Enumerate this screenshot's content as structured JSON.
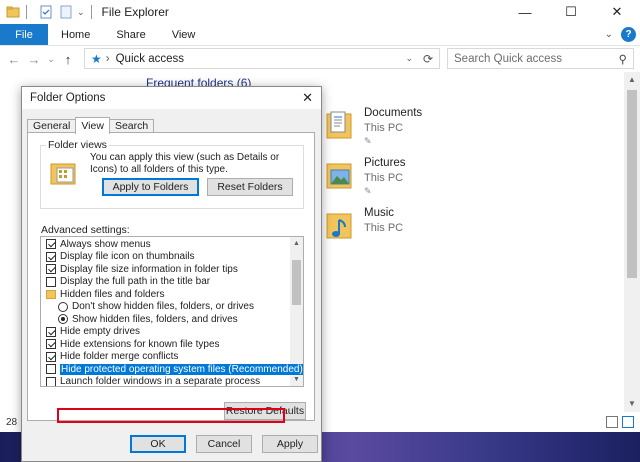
{
  "window": {
    "title": "File Explorer",
    "controls": [
      "—",
      "☐",
      "✕"
    ]
  },
  "ribbon": {
    "file_tab": "File",
    "tabs": [
      "Home",
      "Share",
      "View"
    ],
    "expand": "⌄",
    "help": "?"
  },
  "address": {
    "back": "←",
    "forward": "→",
    "dropdown": "⌄",
    "up": "↑",
    "path_sep": "›",
    "path": "Quick access",
    "search_placeholder": "Search Quick access"
  },
  "content": {
    "section_header": "Frequent folders (6)",
    "folders": [
      {
        "name": "Documents",
        "location": "This PC",
        "pinned": true
      },
      {
        "name": "Pictures",
        "location": "This PC",
        "pinned": true
      },
      {
        "name": "Music",
        "location": "This PC",
        "pinned": false
      }
    ],
    "pin_glyph": "📌"
  },
  "status": {
    "count": "28"
  },
  "dialog": {
    "title": "Folder Options",
    "close": "✕",
    "tabs": [
      "General",
      "View",
      "Search"
    ],
    "active_tab": "View",
    "folder_views": {
      "legend": "Folder views",
      "text": "You can apply this view (such as Details or Icons) to all folders of this type.",
      "apply_button": "Apply to Folders",
      "reset_button": "Reset Folders"
    },
    "advanced_label": "Advanced settings:",
    "advanced_items": [
      {
        "type": "checkbox",
        "label": "Always show menus",
        "checked": true,
        "indent": 0
      },
      {
        "type": "checkbox",
        "label": "Display file icon on thumbnails",
        "checked": true,
        "indent": 0
      },
      {
        "type": "checkbox",
        "label": "Display file size information in folder tips",
        "checked": true,
        "indent": 0
      },
      {
        "type": "checkbox",
        "label": "Display the full path in the title bar",
        "checked": false,
        "indent": 0
      },
      {
        "type": "folder",
        "label": "Hidden files and folders",
        "indent": 0
      },
      {
        "type": "radio",
        "label": "Don't show hidden files, folders, or drives",
        "checked": false,
        "indent": 1
      },
      {
        "type": "radio",
        "label": "Show hidden files, folders, and drives",
        "checked": true,
        "indent": 1
      },
      {
        "type": "checkbox",
        "label": "Hide empty drives",
        "checked": true,
        "indent": 0
      },
      {
        "type": "checkbox",
        "label": "Hide extensions for known file types",
        "checked": true,
        "indent": 0
      },
      {
        "type": "checkbox",
        "label": "Hide folder merge conflicts",
        "checked": true,
        "indent": 0
      },
      {
        "type": "checkbox",
        "label": "Hide protected operating system files (Recommended)",
        "checked": false,
        "indent": 0,
        "highlighted": true
      },
      {
        "type": "checkbox",
        "label": "Launch folder windows in a separate process",
        "checked": false,
        "indent": 0
      }
    ],
    "restore_button": "Restore Defaults",
    "ok_button": "OK",
    "cancel_button": "Cancel",
    "apply_button": "Apply"
  },
  "colors": {
    "accent": "#1979ca",
    "highlight": "#0078d7",
    "annotation": "#e0001b",
    "folder": "#f2c55c"
  }
}
